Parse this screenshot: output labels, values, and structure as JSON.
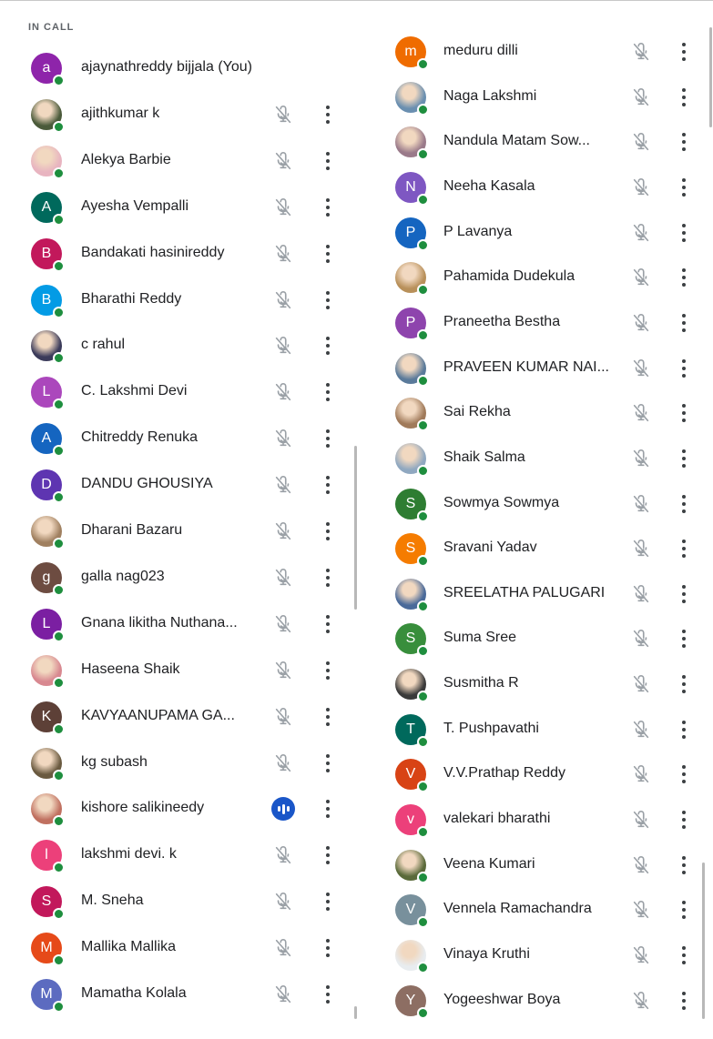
{
  "section_label": "IN CALL",
  "colors": {
    "online_dot": "#1e8e3e",
    "speaking_bg": "#1a56c8",
    "icon_gray": "#9aa0a6",
    "text": "#202124"
  },
  "left": [
    {
      "name": "ajaynathreddy bijjala (You)",
      "initial": "a",
      "avatar_color": "#8e24aa",
      "status": "self"
    },
    {
      "name": "ajithkumar k",
      "initial": "",
      "avatar_color": "#4a5a3a",
      "photo": true,
      "status": "muted"
    },
    {
      "name": "Alekya Barbie",
      "initial": "",
      "avatar_color": "#e8b4c0",
      "photo": true,
      "status": "muted"
    },
    {
      "name": "Ayesha Vempalli",
      "initial": "A",
      "avatar_color": "#00695c",
      "status": "muted"
    },
    {
      "name": "Bandakati hasinireddy",
      "initial": "B",
      "avatar_color": "#c2185b",
      "status": "muted"
    },
    {
      "name": "Bharathi Reddy",
      "initial": "B",
      "avatar_color": "#039be5",
      "status": "muted"
    },
    {
      "name": "c rahul",
      "initial": "",
      "avatar_color": "#3b3b5a",
      "photo": true,
      "status": "muted"
    },
    {
      "name": "C. Lakshmi Devi",
      "initial": "L",
      "avatar_color": "#ab47bc",
      "status": "muted"
    },
    {
      "name": "Chitreddy Renuka",
      "initial": "A",
      "avatar_color": "#1565c0",
      "status": "muted"
    },
    {
      "name": "DANDU GHOUSIYA",
      "initial": "D",
      "avatar_color": "#5e35b1",
      "status": "muted"
    },
    {
      "name": "Dharani Bazaru",
      "initial": "",
      "avatar_color": "#a08060",
      "photo": true,
      "status": "muted"
    },
    {
      "name": "galla nag023",
      "initial": "g",
      "avatar_color": "#6d4c41",
      "status": "muted"
    },
    {
      "name": "Gnana likitha Nuthana...",
      "initial": "L",
      "avatar_color": "#7b1fa2",
      "status": "muted"
    },
    {
      "name": "Haseena Shaik",
      "initial": "",
      "avatar_color": "#d88890",
      "photo": true,
      "status": "muted"
    },
    {
      "name": "KAVYAANUPAMA GA...",
      "initial": "K",
      "avatar_color": "#5d4037",
      "status": "muted"
    },
    {
      "name": "kg subash",
      "initial": "",
      "avatar_color": "#6a5a40",
      "photo": true,
      "status": "muted"
    },
    {
      "name": "kishore salikineedy",
      "initial": "",
      "avatar_color": "#c07060",
      "photo": true,
      "status": "speaking"
    },
    {
      "name": "lakshmi devi. k",
      "initial": "l",
      "avatar_color": "#ec407a",
      "status": "muted"
    },
    {
      "name": "M. Sneha",
      "initial": "S",
      "avatar_color": "#c2185b",
      "status": "muted"
    },
    {
      "name": "Mallika Mallika",
      "initial": "M",
      "avatar_color": "#e64a19",
      "status": "muted"
    },
    {
      "name": "Mamatha Kolala",
      "initial": "M",
      "avatar_color": "#5c6bc0",
      "status": "muted"
    }
  ],
  "right": [
    {
      "name": "meduru dilli",
      "initial": "m",
      "avatar_color": "#ef6c00",
      "status": "muted"
    },
    {
      "name": "Naga Lakshmi",
      "initial": "",
      "avatar_color": "#6a8fb0",
      "photo": true,
      "status": "muted"
    },
    {
      "name": "Nandula Matam Sow...",
      "initial": "",
      "avatar_color": "#9a7a8a",
      "photo": true,
      "status": "muted"
    },
    {
      "name": "Neeha Kasala",
      "initial": "N",
      "avatar_color": "#7e57c2",
      "status": "muted"
    },
    {
      "name": "P Lavanya",
      "initial": "P",
      "avatar_color": "#1565c0",
      "status": "muted"
    },
    {
      "name": "Pahamida Dudekula",
      "initial": "",
      "avatar_color": "#b8905a",
      "photo": true,
      "status": "muted"
    },
    {
      "name": "Praneetha Bestha",
      "initial": "P",
      "avatar_color": "#8e44ad",
      "status": "muted"
    },
    {
      "name": "PRAVEEN KUMAR NAI...",
      "initial": "",
      "avatar_color": "#5a7a9a",
      "photo": true,
      "status": "muted"
    },
    {
      "name": "Sai Rekha",
      "initial": "",
      "avatar_color": "#a07a5a",
      "photo": true,
      "status": "muted"
    },
    {
      "name": "Shaik Salma",
      "initial": "",
      "avatar_color": "#90a8c0",
      "photo": true,
      "status": "muted"
    },
    {
      "name": "Sowmya Sowmya",
      "initial": "S",
      "avatar_color": "#2e7d32",
      "status": "muted"
    },
    {
      "name": "Sravani Yadav",
      "initial": "S",
      "avatar_color": "#f57c00",
      "status": "muted"
    },
    {
      "name": "SREELATHA PALUGARI",
      "initial": "",
      "avatar_color": "#4a6a9a",
      "photo": true,
      "status": "muted"
    },
    {
      "name": "Suma Sree",
      "initial": "S",
      "avatar_color": "#388e3c",
      "status": "muted"
    },
    {
      "name": "Susmitha R",
      "initial": "",
      "avatar_color": "#3a3a3a",
      "photo": true,
      "status": "muted"
    },
    {
      "name": "T. Pushpavathi",
      "initial": "T",
      "avatar_color": "#00695c",
      "status": "muted"
    },
    {
      "name": "V.V.Prathap Reddy",
      "initial": "V",
      "avatar_color": "#d84315",
      "status": "muted"
    },
    {
      "name": "valekari bharathi",
      "initial": "v",
      "avatar_color": "#ec407a",
      "status": "muted"
    },
    {
      "name": "Veena Kumari",
      "initial": "",
      "avatar_color": "#5a6a3a",
      "photo": true,
      "status": "muted"
    },
    {
      "name": "Vennela Ramachandra",
      "initial": "V",
      "avatar_color": "#78909c",
      "status": "muted"
    },
    {
      "name": "Vinaya Kruthi",
      "initial": "",
      "avatar_color": "#e8ecef",
      "photo": true,
      "status": "muted"
    },
    {
      "name": "Yogeeshwar Boya",
      "initial": "Y",
      "avatar_color": "#8d6e63",
      "status": "muted"
    }
  ]
}
